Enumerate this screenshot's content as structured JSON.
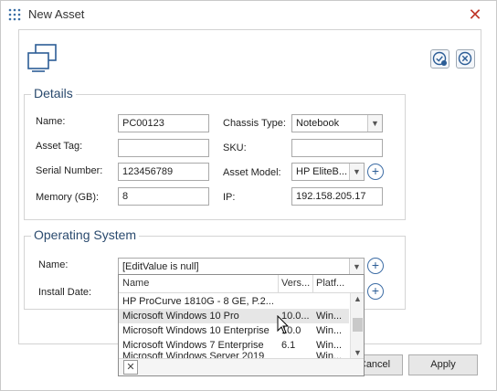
{
  "window": {
    "title": "New Asset"
  },
  "details": {
    "group_title": "Details",
    "name_label": "Name:",
    "name_value": "PC00123",
    "asset_tag_label": "Asset Tag:",
    "asset_tag_value": "",
    "serial_label": "Serial Number:",
    "serial_value": "123456789",
    "memory_label": "Memory (GB):",
    "memory_value": "8",
    "chassis_label": "Chassis Type:",
    "chassis_value": "Notebook",
    "sku_label": "SKU:",
    "sku_value": "",
    "model_label": "Asset Model:",
    "model_value": "HP EliteB...",
    "ip_label": "IP:",
    "ip_value": "192.158.205.17"
  },
  "os": {
    "group_title": "Operating System",
    "name_label": "Name:",
    "name_value": "[EditValue is null]",
    "install_label": "Install Date:"
  },
  "dropdown": {
    "columns": [
      "Name",
      "Vers...",
      "Platf..."
    ],
    "rows": [
      {
        "name": "HP ProCurve 1810G - 8 GE, P.2....",
        "version": "",
        "platform": ""
      },
      {
        "name": "Microsoft Windows 10 Pro",
        "version": "10.0...",
        "platform": "Win..."
      },
      {
        "name": "Microsoft Windows 10 Enterprise",
        "version": "10.0",
        "platform": "Win..."
      },
      {
        "name": "Microsoft Windows 7 Enterprise",
        "version": "6.1",
        "platform": "Win..."
      },
      {
        "name": "Microsoft Windows Server 2019",
        "version": "",
        "platform": "Win..."
      }
    ],
    "close_glyph": "✕"
  },
  "buttons": {
    "cancel": "Cancel",
    "apply": "Apply"
  },
  "colors": {
    "accent": "#2c5d96",
    "close": "#c0392b",
    "group_title": "#2a4a6e"
  }
}
